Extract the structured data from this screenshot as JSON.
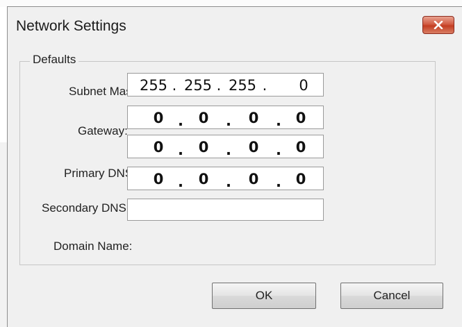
{
  "window": {
    "title": "Network Settings"
  },
  "group": {
    "legend": "Defaults"
  },
  "fields": {
    "subnet_mask": {
      "label": "Subnet Mask:",
      "octets": [
        "255",
        "255",
        "255",
        "0"
      ]
    },
    "gateway": {
      "label": "Gateway:",
      "octets": [
        "0",
        "0",
        "0",
        "0"
      ]
    },
    "extra_ip": {
      "octets": [
        "0",
        "0",
        "0",
        "0"
      ]
    },
    "primary_dns": {
      "label": "Primary DNS:",
      "octets": [
        "0",
        "0",
        "0",
        "0"
      ]
    },
    "secondary_dns": {
      "label": "Secondary DNS:",
      "value": ""
    },
    "domain_name": {
      "label": "Domain Name:"
    }
  },
  "buttons": {
    "ok": "OK",
    "cancel": "Cancel"
  },
  "icons": {
    "close": "close-icon"
  },
  "colors": {
    "close_button": "#c94a30",
    "window_bg": "#f0f0f0"
  }
}
